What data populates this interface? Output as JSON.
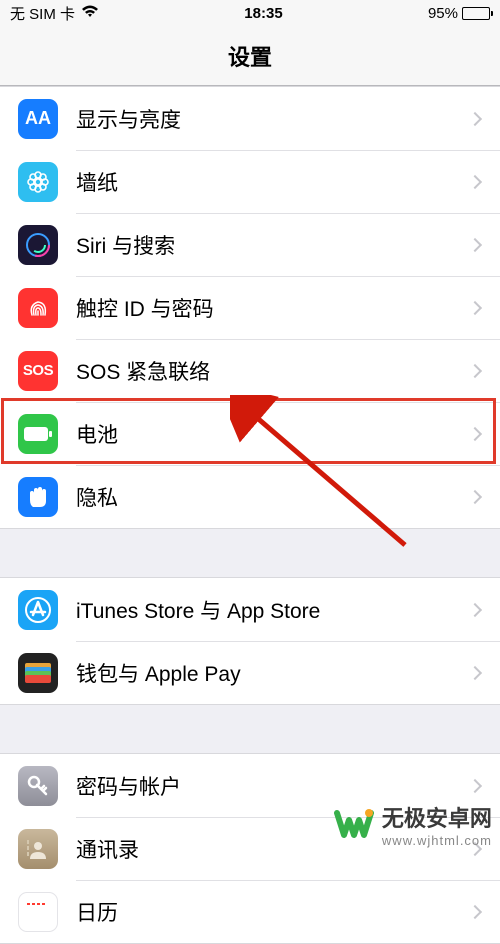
{
  "status": {
    "carrier": "无 SIM 卡",
    "time": "18:35",
    "battery_pct": "95%"
  },
  "nav": {
    "title": "设置"
  },
  "groups": [
    {
      "id": "g1",
      "items": [
        {
          "id": "display",
          "label": "显示与亮度",
          "icon": "display-icon",
          "bg": "#167dff"
        },
        {
          "id": "wallpaper",
          "label": "墙纸",
          "icon": "flower-icon",
          "bg": "#2ebef0"
        },
        {
          "id": "siri",
          "label": "Siri 与搜索",
          "icon": "siri-icon",
          "bg": "#1b1734"
        },
        {
          "id": "touchid",
          "label": "触控 ID 与密码",
          "icon": "fingerprint-icon",
          "bg": "#ff3331"
        },
        {
          "id": "sos",
          "label": "SOS 紧急联络",
          "icon": "sos-icon",
          "bg": "#ff3331"
        },
        {
          "id": "battery",
          "label": "电池",
          "icon": "battery-icon",
          "bg": "#30c649",
          "highlighted": true
        },
        {
          "id": "privacy",
          "label": "隐私",
          "icon": "hand-icon",
          "bg": "#167dff"
        }
      ]
    },
    {
      "id": "g2",
      "items": [
        {
          "id": "itunes",
          "label": "iTunes Store 与 App Store",
          "icon": "appstore-icon",
          "bg": "#1aa4f6"
        },
        {
          "id": "wallet",
          "label": "钱包与 Apple Pay",
          "icon": "wallet-icon",
          "bg": "#222"
        }
      ]
    },
    {
      "id": "g3",
      "items": [
        {
          "id": "accounts",
          "label": "密码与帐户",
          "icon": "key-icon",
          "bg": "#9b9ba4"
        },
        {
          "id": "contacts",
          "label": "通讯录",
          "icon": "contacts-icon",
          "bg": "#b7a083"
        },
        {
          "id": "calendar",
          "label": "日历",
          "icon": "calendar-icon",
          "bg": "#fff"
        }
      ]
    }
  ],
  "watermark": {
    "brand": "无极安卓网",
    "url": "www.wjhtml.com"
  },
  "colors": {
    "highlight": "#e03a2a",
    "arrow": "#d11a0a"
  }
}
